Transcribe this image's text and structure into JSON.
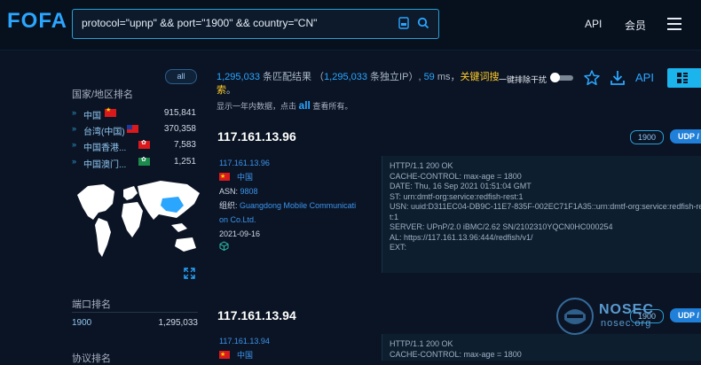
{
  "header": {
    "logo": "FOFA",
    "search_value": "protocol=\"upnp\" && port=\"1900\" && country=\"CN\"",
    "nav": {
      "api": "API",
      "member": "会员"
    }
  },
  "sidebar": {
    "all_label": "all",
    "region_title": "国家/地区排名",
    "regions": [
      {
        "name": "中国",
        "flag": "cn-flag",
        "count": "915,841"
      },
      {
        "name": "台湾(中国)",
        "flag": "tw-flag",
        "count": "370,358"
      },
      {
        "name": "中国香港...",
        "flag": "hk-flag",
        "count": "7,583"
      },
      {
        "name": "中国澳门...",
        "flag": "mo-flag",
        "count": "1,251"
      }
    ],
    "port_title": "端口排名",
    "ports": [
      {
        "port": "1900",
        "count": "1,295,033"
      }
    ],
    "protocol_title": "协议排名"
  },
  "summary": {
    "total": "1,295,033",
    "text1": " 条匹配结果 （",
    "ip_count": "1,295,033",
    "text2": " 条独立IP）, ",
    "ms": "59",
    "text3": " ms，",
    "keyword": "关键词搜索",
    "text4": "。",
    "hint_pre": "显示一年内数据，点击 ",
    "hint_all": "all",
    "hint_post": " 查看所有。",
    "toggle_label": "一键排除干扰",
    "api_label": "API"
  },
  "results": [
    {
      "ip": "117.161.13.96",
      "port": "1900",
      "protocol": "UDP /",
      "ip_link": "117.161.13.96",
      "country": "中国",
      "asn_label": "ASN: ",
      "asn": "9808",
      "org_label": "组织: ",
      "org_line1": "Guangdong Mobile Communicati",
      "org_line2": "on Co.Ltd.",
      "date": "2021-09-16",
      "banner": "HTTP/1.1 200 OK\nCACHE-CONTROL: max-age = 1800\nDATE: Thu, 16 Sep 2021 01:51:04 GMT\nST: urn:dmtf-org:service:redfish-rest:1\nUSN: uuid:D311EC04-DB9C-11E7-835F-002EC71F1A35::urn:dmtf-org:service:redfish-rest:1\nt:1\nSERVER: UPnP/2.0 iBMC/2.62 SN/2102310YQCN0HC000254\nAL: https://117.161.13.96:444/redfish/v1/\nEXT:"
    },
    {
      "ip": "117.161.13.94",
      "port": "1900",
      "protocol": "UDP /",
      "ip_link": "117.161.13.94",
      "country": "中国",
      "banner": "HTTP/1.1 200 OK\nCACHE-CONTROL: max-age = 1800"
    }
  ],
  "watermark": {
    "brand": "NOSEC",
    "domain": "nosec.org"
  },
  "colors": {
    "accent": "#2aa6ff",
    "keyword": "#ffcc2a",
    "background": "#0b1424",
    "udp_badge": "#1f7fd9"
  }
}
